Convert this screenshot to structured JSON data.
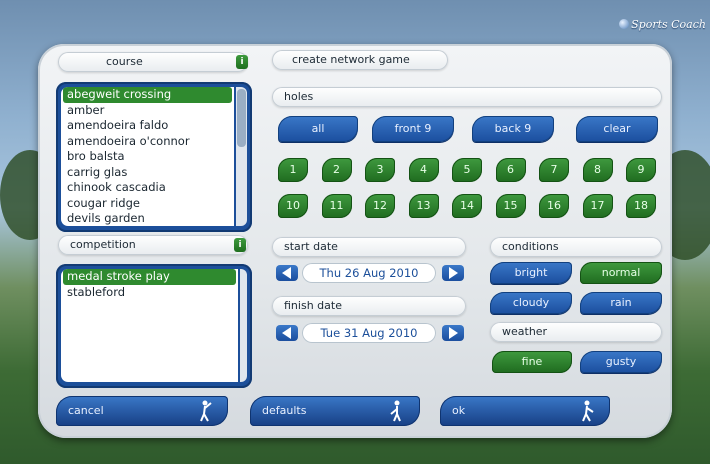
{
  "brand": {
    "text": "Sports Coach"
  },
  "course": {
    "header": "course",
    "info": "i",
    "items": [
      "abegweit crossing",
      "amber",
      "amendoeira faldo",
      "amendoeira o'connor",
      "bro balsta",
      "carrig glas",
      "chinook cascadia",
      "cougar ridge",
      "devils garden"
    ],
    "selected_index": 0
  },
  "competition": {
    "header": "competition",
    "info": "i",
    "items": [
      "medal stroke play",
      "stableford"
    ],
    "selected_index": 0
  },
  "network": {
    "label": "create network game"
  },
  "holes": {
    "header": "holes",
    "buttons": [
      "all",
      "front 9",
      "back 9",
      "clear"
    ],
    "numbers": [
      "1",
      "2",
      "3",
      "4",
      "5",
      "6",
      "7",
      "8",
      "9",
      "10",
      "11",
      "12",
      "13",
      "14",
      "15",
      "16",
      "17",
      "18"
    ]
  },
  "start": {
    "header": "start date",
    "value": "Thu 26 Aug 2010"
  },
  "finish": {
    "header": "finish date",
    "value": "Tue 31 Aug 2010"
  },
  "conditions": {
    "header": "conditions",
    "options": [
      "bright",
      "normal",
      "cloudy",
      "rain"
    ],
    "selected": "normal"
  },
  "weather": {
    "header": "weather",
    "options": [
      "fine",
      "gusty"
    ],
    "selected": "fine"
  },
  "footer": {
    "cancel": "cancel",
    "defaults": "defaults",
    "ok": "ok"
  },
  "colors": {
    "accent_blue": "#1c4f9a",
    "accent_green": "#2f8a2f"
  }
}
